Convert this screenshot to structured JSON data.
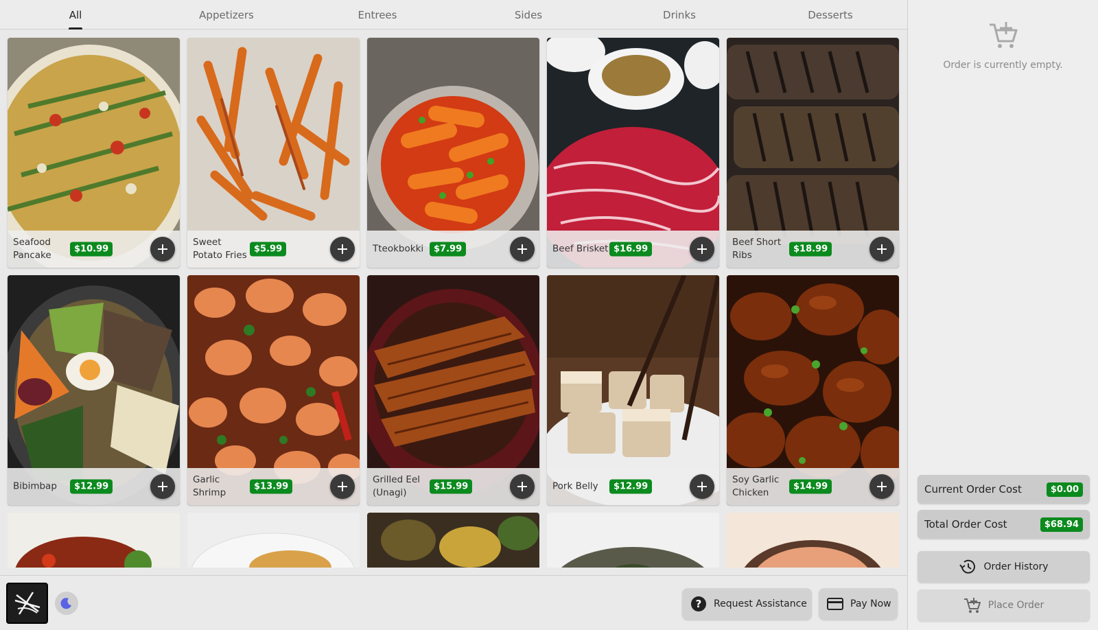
{
  "tabs": [
    {
      "label": "All",
      "active": true
    },
    {
      "label": "Appetizers",
      "active": false
    },
    {
      "label": "Entrees",
      "active": false
    },
    {
      "label": "Sides",
      "active": false
    },
    {
      "label": "Drinks",
      "active": false
    },
    {
      "label": "Desserts",
      "active": false
    }
  ],
  "menu_items": [
    {
      "name": "Seafood Pancake",
      "price": "$10.99"
    },
    {
      "name": "Sweet Potato Fries",
      "price": "$5.99"
    },
    {
      "name": "Tteokbokki",
      "price": "$7.99"
    },
    {
      "name": "Beef Brisket",
      "price": "$16.99"
    },
    {
      "name": "Beef Short Ribs",
      "price": "$18.99"
    },
    {
      "name": "Bibimbap",
      "price": "$12.99"
    },
    {
      "name": "Garlic Shrimp",
      "price": "$13.99"
    },
    {
      "name": "Grilled Eel (Unagi)",
      "price": "$15.99"
    },
    {
      "name": "Pork Belly",
      "price": "$12.99"
    },
    {
      "name": "Soy Garlic Chicken",
      "price": "$14.99"
    }
  ],
  "bottom_bar": {
    "request_assistance_label": "Request Assistance",
    "pay_now_label": "Pay Now"
  },
  "order_panel": {
    "empty_message": "Order is currently empty.",
    "current_cost_label": "Current Order Cost",
    "current_cost_value": "$0.00",
    "total_cost_label": "Total Order Cost",
    "total_cost_value": "$68.94",
    "order_history_label": "Order History",
    "place_order_label": "Place Order"
  },
  "colors": {
    "price_badge": "#0b8a1e",
    "add_button": "#3a3a3a",
    "theme_icon": "#5a63e6"
  }
}
